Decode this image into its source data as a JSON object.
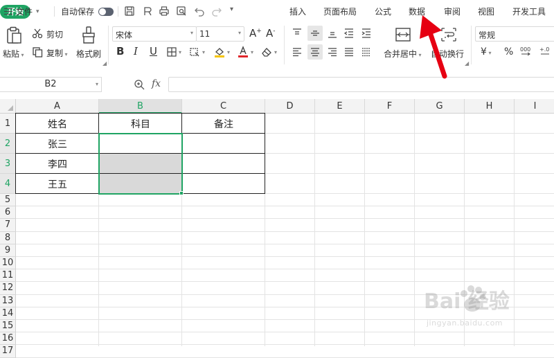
{
  "menubar": {
    "file_label": "文件",
    "autosave_label": "自动保存",
    "tabs": [
      "开始",
      "插入",
      "页面布局",
      "公式",
      "数据",
      "审阅",
      "视图",
      "开发工具"
    ]
  },
  "ribbon": {
    "paste": "粘贴",
    "cut": "剪切",
    "copy": "复制",
    "format_painter": "格式刷",
    "font_name": "宋体",
    "font_size": "11",
    "merge_center": "合并居中",
    "wrap_text": "自动换行",
    "number_format": "常规",
    "currency_symbol": "¥",
    "percent_symbol": "%"
  },
  "formula_bar": {
    "name_box": "B2",
    "fx": "fx",
    "value": ""
  },
  "sheet": {
    "columns": [
      "A",
      "B",
      "C",
      "D",
      "E",
      "F",
      "G",
      "H",
      "I"
    ],
    "rows": [
      "1",
      "2",
      "3",
      "4",
      "5",
      "6",
      "7",
      "8",
      "9",
      "10",
      "11",
      "12",
      "13",
      "14",
      "15",
      "16",
      "17"
    ],
    "cells": {
      "A1": "姓名",
      "B1": "科目",
      "C1": "备注",
      "A2": "张三",
      "A3": "李四",
      "A4": "王五"
    },
    "selected_cell": "B2",
    "selected_range": "B2:B4"
  },
  "watermark": {
    "brand": "Bai  经验",
    "url": "jingyan.baidu.com"
  },
  "colors": {
    "accent": "#1fa463",
    "arrow": "#e60012",
    "shade": "#d9d9d9"
  },
  "icons": [
    "menu-icon",
    "toggle-icon",
    "save-icon",
    "print-icon",
    "print-preview-icon",
    "undo-icon",
    "redo-icon",
    "paste-icon",
    "scissors-icon",
    "copy-icon",
    "brush-icon",
    "bold-icon",
    "italic-icon",
    "underline-icon",
    "border-icon",
    "fill-color-icon",
    "font-color-icon",
    "eraser-icon",
    "align-top-icon",
    "align-middle-icon",
    "align-bottom-icon",
    "merge-icon",
    "wrap-icon",
    "zoom-icon",
    "fx-icon",
    "arrow-annotation-icon"
  ]
}
